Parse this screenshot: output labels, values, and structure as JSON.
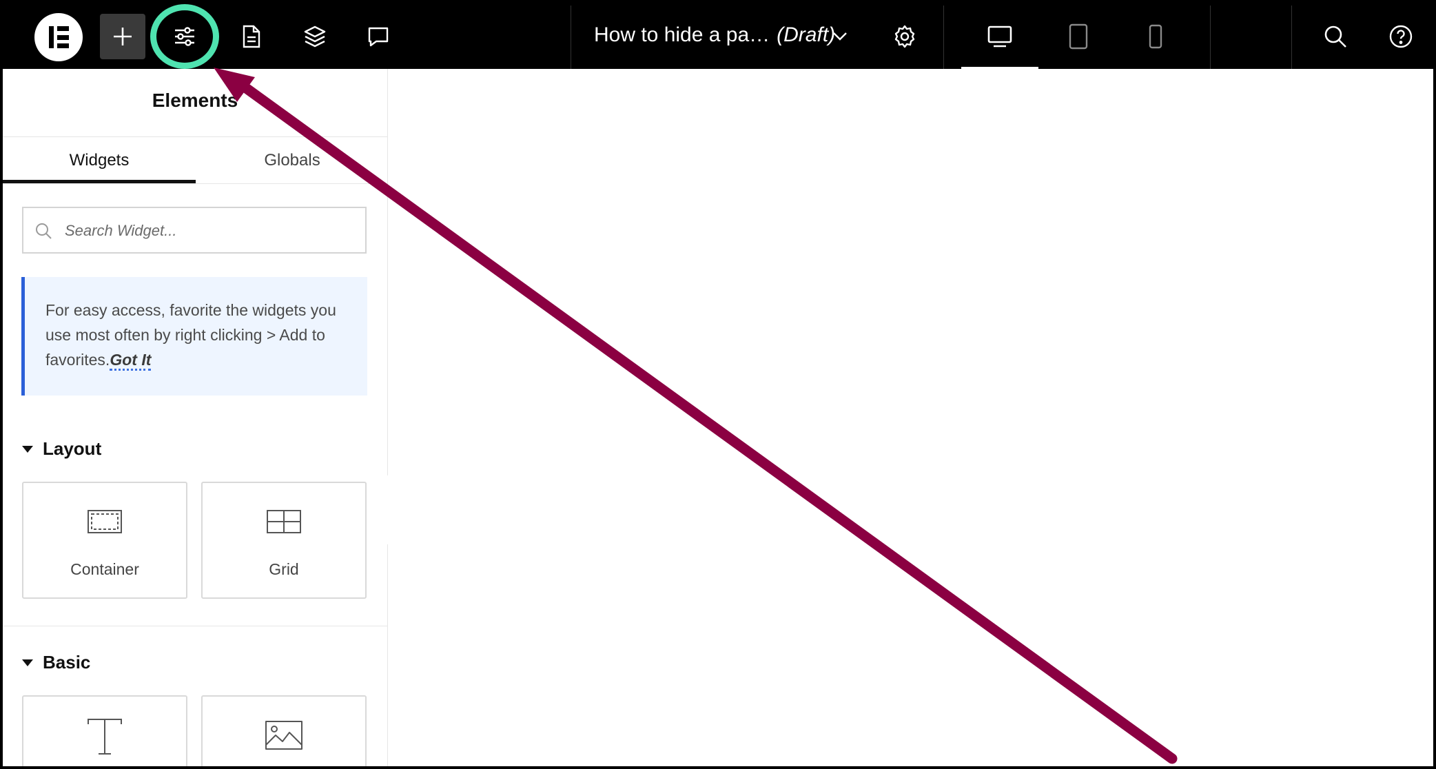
{
  "topbar": {
    "document_title": "How to hide a pa…",
    "document_status": "(Draft)"
  },
  "panel": {
    "title": "Elements",
    "tabs": [
      {
        "label": "Widgets"
      },
      {
        "label": "Globals"
      }
    ],
    "search_placeholder": "Search Widget...",
    "tip": {
      "text": "For easy access, favorite the widgets you use most often by right clicking > Add to favorites.",
      "link": "Got It"
    },
    "sections": [
      {
        "title": "Layout",
        "items": [
          {
            "label": "Container"
          },
          {
            "label": "Grid"
          }
        ]
      },
      {
        "title": "Basic"
      }
    ]
  },
  "colors": {
    "highlight": "#4fe3b0",
    "annotation_arrow": "#8b0042",
    "tip_accent": "#2a5fd8"
  }
}
